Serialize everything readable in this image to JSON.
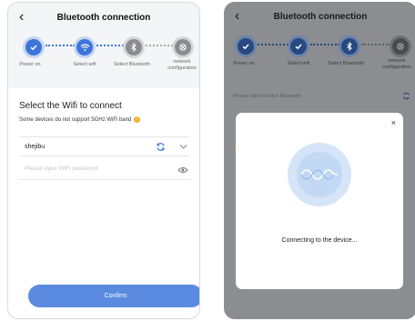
{
  "left_screen": {
    "title": "Bluetooth connection",
    "back_icon": "‹",
    "steps": [
      {
        "label": "Power on",
        "state": "done"
      },
      {
        "label": "Select wifi",
        "state": "done"
      },
      {
        "label": "Select Bluetooth",
        "state": "todo"
      },
      {
        "label": "network configuration",
        "state": "todo"
      }
    ],
    "heading": "Select the Wifi to connect",
    "note": "Some devices do not support 5GHz WiFi band",
    "ssid_value": "shejibu",
    "password_placeholder": "Please input WiFi password",
    "confirm_label": "Confirm"
  },
  "right_screen": {
    "title": "Bluetooth connection",
    "back_icon": "‹",
    "steps": [
      {
        "label": "Power on",
        "state": "done"
      },
      {
        "label": "Select wifi",
        "state": "done"
      },
      {
        "label": "Select Bluetooth",
        "state": "done"
      },
      {
        "label": "network configuration",
        "state": "todo"
      }
    ],
    "prompt": "Please select device Bluetooth",
    "modal": {
      "close_icon": "×",
      "message": "Connecting to the device..."
    }
  },
  "colors": {
    "accent": "#3d74d8",
    "button": "#5a8be0",
    "warning": "#f2b233",
    "overlay": "#8c8d90"
  }
}
